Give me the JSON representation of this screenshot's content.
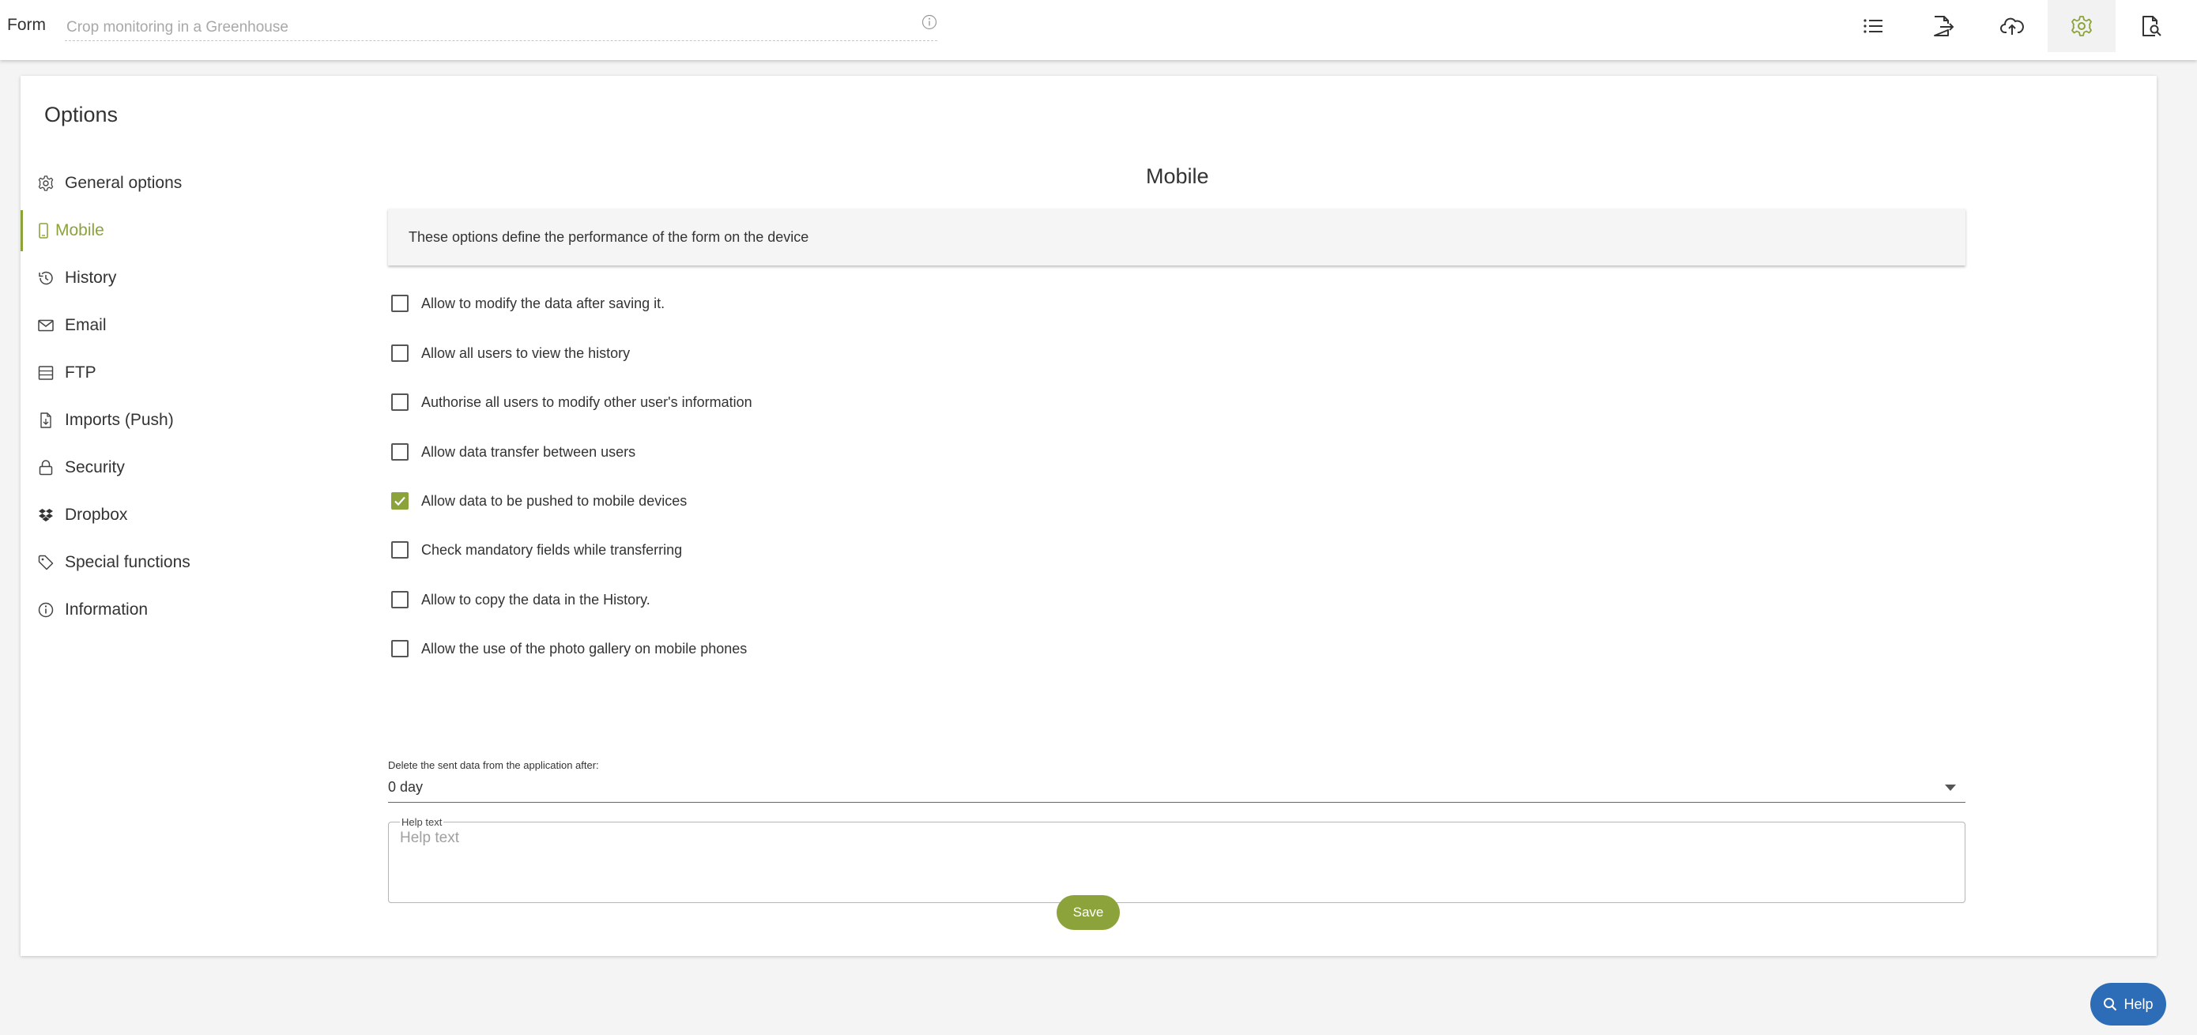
{
  "topbar": {
    "form_label": "Form",
    "title_placeholder": "Crop monitoring in a Greenhouse",
    "buttons": [
      {
        "icon": "list-icon"
      },
      {
        "icon": "export-icon"
      },
      {
        "icon": "cloud-upload-icon"
      },
      {
        "icon": "gear-icon",
        "active": true
      },
      {
        "icon": "document-search-icon"
      }
    ]
  },
  "options": {
    "title": "Options",
    "sidebar": [
      {
        "label": "General options",
        "icon": "gear-icon"
      },
      {
        "label": "Mobile",
        "icon": "mobile-icon",
        "active": true
      },
      {
        "label": "History",
        "icon": "history-icon"
      },
      {
        "label": "Email",
        "icon": "envelope-icon"
      },
      {
        "label": "FTP",
        "icon": "server-icon"
      },
      {
        "label": "Imports (Push)",
        "icon": "file-import-icon"
      },
      {
        "label": "Security",
        "icon": "lock-icon"
      },
      {
        "label": "Dropbox",
        "icon": "dropbox-icon"
      },
      {
        "label": "Special functions",
        "icon": "tag-icon"
      },
      {
        "label": "Information",
        "icon": "info-icon"
      }
    ]
  },
  "mobile": {
    "title": "Mobile",
    "description": "These options define the performance of the form on the device",
    "checkboxes": [
      {
        "label": "Allow to modify the data after saving it.",
        "checked": false
      },
      {
        "label": "Allow all users to view the history",
        "checked": false
      },
      {
        "label": "Authorise all users to modify other user's information",
        "checked": false
      },
      {
        "label": "Allow data transfer between users",
        "checked": false
      },
      {
        "label": "Allow data to be pushed to mobile devices",
        "checked": true
      },
      {
        "label": "Check mandatory fields while transferring",
        "checked": false
      },
      {
        "label": "Allow to copy the data in the History.",
        "checked": false
      },
      {
        "label": "Allow the use of the photo gallery on mobile phones",
        "checked": false
      }
    ],
    "delete_label": "Delete the sent data from the application after:",
    "delete_value": "0 day",
    "help_legend": "Help text",
    "help_placeholder": "Help text",
    "save_label": "Save"
  },
  "help_button": "Help",
  "colors": {
    "accent": "#8ba33a",
    "help_blue": "#2d6cb6"
  }
}
